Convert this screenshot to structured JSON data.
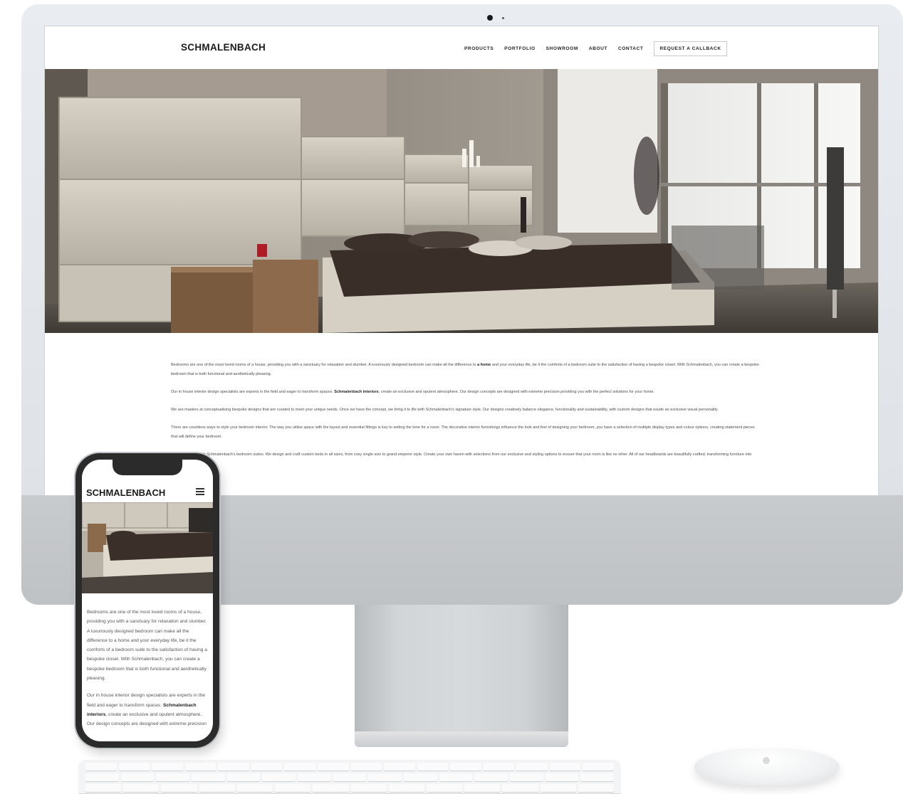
{
  "desktop": {
    "logo": "SCHMALENBACH",
    "nav": [
      "PRODUCTS",
      "PORTFOLIO",
      "SHOWROOM",
      "ABOUT",
      "CONTACT"
    ],
    "cta": "REQUEST A CALLBACK",
    "paragraphs": [
      [
        {
          "t": "Bedrooms are one of the most loved rooms of a house, providing you with a sanctuary for relaxation and slumber. A luxuriously designed bedroom can make all the difference to "
        },
        {
          "t": "a home",
          "b": true
        },
        {
          "t": " and your everyday life, be it the comforts of a bedroom suite to the satisfaction of having a bespoke closet. With Schmalenbach, you can create a bespoke bedroom that is both functional and aesthetically pleasing."
        }
      ],
      [
        {
          "t": "Our in house interior design specialists are experts in the field and eager to transform spaces. "
        },
        {
          "t": "Schmalenbach interiors",
          "b": true
        },
        {
          "t": ", create an exclusive and opulent atmosphere. Our design concepts are designed with extreme precision providing you with the perfect solutions for your home."
        }
      ],
      [
        {
          "t": "We are masters at conceptualising bespoke designs that are curated to meet your unique needs. Once we have the concept, we bring it to life with Schmalenbach's signature style. Our designs creatively balance elegance, functionality and sustainability, with custom designs that exude an exclusive visual personality."
        }
      ],
      [
        {
          "t": "There are countless ways to style your bedroom interior. The way you utilise space with the layout and essential fittings is key to setting the tone for a room. The decorative interior furnishings influence the look and feel of designing your bedroom, you have a selection of multiple display types and colour options, creating statement pieces that will define your bedroom."
        }
      ],
      [
        {
          "t": "rest every night with Schmalenbach's bedroom suites. We design and craft custom beds in all sizes, from cosy single size to grand emperor style. Create your own haven with selections from our exclusive and styling options to ensure that your room is like no other. All of our headboards are beautifully crafted, transforming furniture into works of art."
        }
      ]
    ]
  },
  "mobile": {
    "logo": "SCHMALENBACH",
    "paragraphs": [
      [
        {
          "t": "Bedrooms are one of the most loved rooms of a house, providing you with a sanctuary for relaxation and slumber. A luxuriously designed bedroom can make all the difference to a home and your everyday life, be it the comforts of a bedroom suite to the satisfaction of having a bespoke closet. With Schmalenbach, you can create a bespoke bedroom that is both functional and aesthetically pleasing."
        }
      ],
      [
        {
          "t": "Our in house interior design specialists are experts in the field and eager to transform spaces. "
        },
        {
          "t": "Schmalenbach interiors",
          "b": true
        },
        {
          "t": ", create an exclusive and opulent atmosphere. Our design concepts are designed with extreme precision"
        }
      ]
    ]
  }
}
